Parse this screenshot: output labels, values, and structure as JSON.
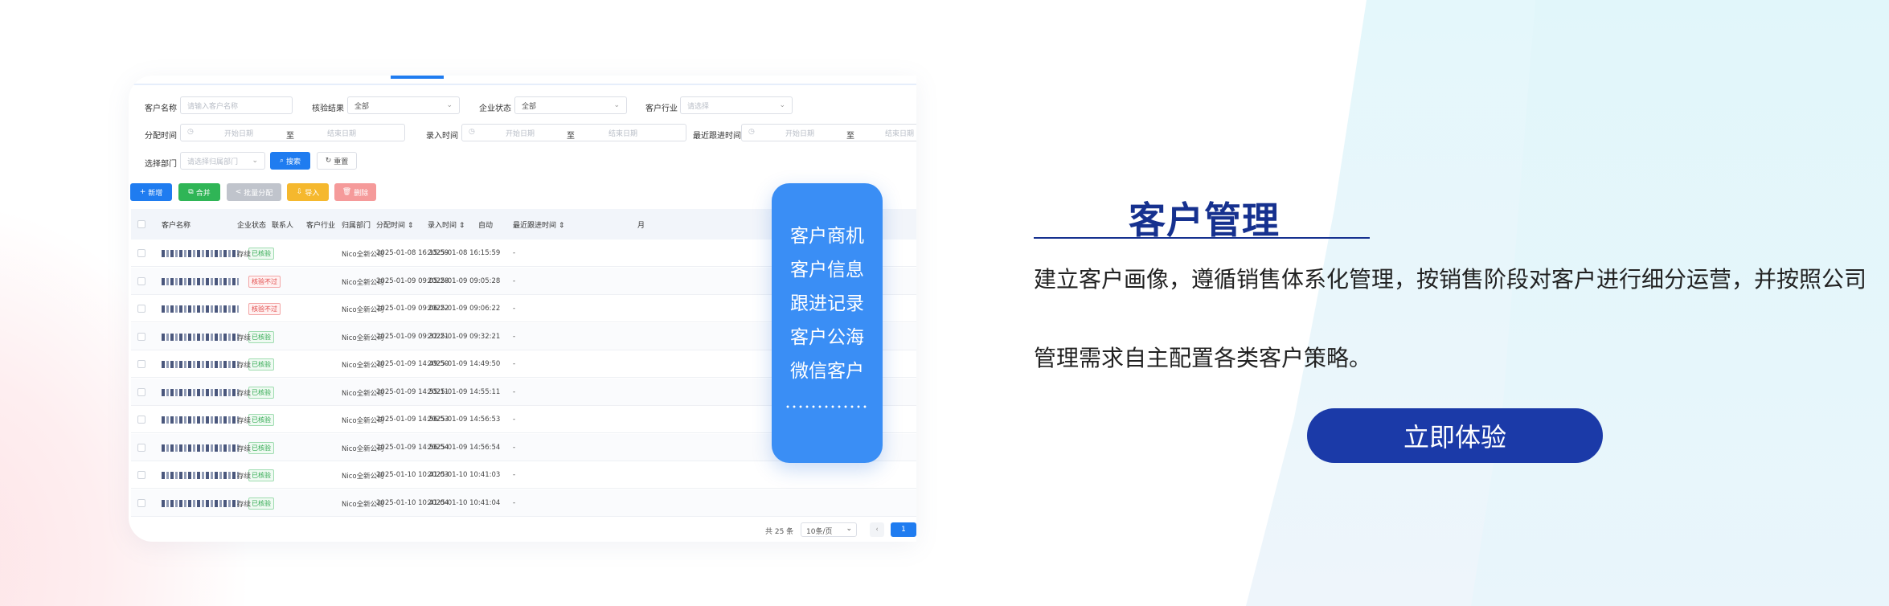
{
  "filters": {
    "customer_name_label": "客户名称",
    "customer_name_placeholder": "请输入客户名称",
    "verify_label": "核验结果",
    "verify_value": "全部",
    "status_label": "企业状态",
    "status_value": "全部",
    "industry_label": "客户行业",
    "industry_placeholder": "请选择",
    "assign_time_label": "分配时间",
    "entry_time_label": "录入时间",
    "follow_time_label": "最近跟进时间",
    "start_placeholder": "开始日期",
    "end_placeholder": "结束日期",
    "range_sep": "至",
    "dept_label": "选择部门",
    "dept_placeholder": "请选择归属部门",
    "search_btn": "搜索",
    "reset_btn": "重置"
  },
  "toolbar": {
    "add": "新增",
    "merge": "合并",
    "batch_assign": "批量分配",
    "import": "导入",
    "delete": "删除"
  },
  "colors": {
    "add": "#1f7cf0",
    "merge": "#2fb556",
    "batch_assign": "#c0c4cc",
    "import": "#f5b82e",
    "delete": "#f59a9a",
    "primary": "#1f7cf0"
  },
  "table": {
    "headers": {
      "name": "客户名称",
      "status": "企业状态",
      "contact": "联系人",
      "industry": "客户行业",
      "dept": "归属部门",
      "assign_time": "分配时间",
      "entry_time": "录入时间",
      "source": "自动",
      "follow_time": "最近跟进时间",
      "extra": "月"
    },
    "rows": [
      {
        "tag": "已核验",
        "tag_type": "ok",
        "status": "存续",
        "dept": "Nico全新公司",
        "assign": "2025-01-08 16:15:59",
        "entry": "2025-01-08 16:15:59",
        "follow": "-"
      },
      {
        "tag": "核验不过",
        "tag_type": "bad",
        "status": "",
        "dept": "Nico全新公司",
        "assign": "2025-01-09 09:05:28",
        "entry": "2025-01-09 09:05:28",
        "follow": "-"
      },
      {
        "tag": "核验不过",
        "tag_type": "bad",
        "status": "",
        "dept": "Nico全新公司",
        "assign": "2025-01-09 09:06:22",
        "entry": "2025-01-09 09:06:22",
        "follow": "-"
      },
      {
        "tag": "已核验",
        "tag_type": "ok",
        "status": "存续",
        "dept": "Nico全新公司",
        "assign": "2025-01-09 09:32:21",
        "entry": "2025-01-09 09:32:21",
        "follow": "-"
      },
      {
        "tag": "已核验",
        "tag_type": "ok",
        "status": "存续",
        "dept": "Nico全新公司",
        "assign": "2025-01-09 14:49:50",
        "entry": "2025-01-09 14:49:50",
        "follow": "-"
      },
      {
        "tag": "已核验",
        "tag_type": "ok",
        "status": "存续",
        "dept": "Nico全新公司",
        "assign": "2025-01-09 14:55:11",
        "entry": "2025-01-09 14:55:11",
        "follow": "-"
      },
      {
        "tag": "已核验",
        "tag_type": "ok",
        "status": "存续",
        "dept": "Nico全新公司",
        "assign": "2025-01-09 14:56:53",
        "entry": "2025-01-09 14:56:53",
        "follow": "-"
      },
      {
        "tag": "已核验",
        "tag_type": "ok",
        "status": "存续",
        "dept": "Nico全新公司",
        "assign": "2025-01-09 14:56:54",
        "entry": "2025-01-09 14:56:54",
        "follow": "-"
      },
      {
        "tag": "已核验",
        "tag_type": "ok",
        "status": "存续",
        "dept": "Nico全新公司",
        "assign": "2025-01-10 10:41:03",
        "entry": "2025-01-10 10:41:03",
        "follow": "-"
      },
      {
        "tag": "已核验",
        "tag_type": "ok",
        "status": "存续",
        "dept": "Nico全新公司",
        "assign": "2025-01-10 10:41:04",
        "entry": "2025-01-10 10:41:04",
        "follow": "-"
      }
    ]
  },
  "pager": {
    "total": "共 25 条",
    "size": "10条/页",
    "prev": "‹",
    "current": "1"
  },
  "float_menu": {
    "items": [
      "客户商机",
      "客户信息",
      "跟进记录",
      "客户公海",
      "微信客户"
    ]
  },
  "promo": {
    "title": "客户管理",
    "desc_line1": "建立客户画像，遵循销售体系化管理，按销售阶段对客户进行细分运营，并按照公司",
    "desc_line2": "管理需求自主配置各类客户策略。",
    "cta": "立即体验"
  }
}
